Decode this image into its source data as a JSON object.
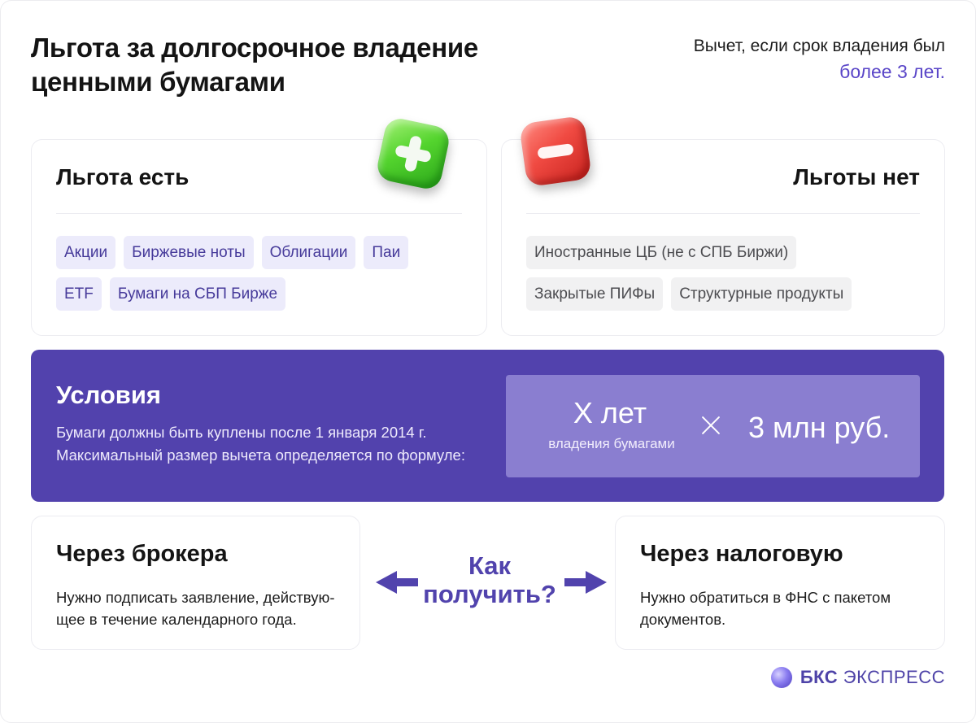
{
  "header": {
    "title": "Льгота за долгосрочное владение ценными бумагами",
    "note": "Вычет, если срок владения был",
    "note_accent": "более 3 лет."
  },
  "benefit_yes": {
    "heading": "Льгота есть",
    "icon": "plus-icon",
    "tags": [
      "Акции",
      "Биржевые ноты",
      "Облигации",
      "Паи",
      "ETF",
      "Бумаги на СБП Бирже"
    ]
  },
  "benefit_no": {
    "heading": "Льготы нет",
    "icon": "minus-icon",
    "tags": [
      "Иностранные ЦБ (не с СПБ Биржи)",
      "Закрытые ПИФы",
      "Структурные продукты"
    ]
  },
  "conditions": {
    "heading": "Условия",
    "line1": "Бумаги должны быть куплены после 1 января 2014 г.",
    "line2": "Максимальный размер вычета определяется по формуле:",
    "formula_years": "X лет",
    "formula_years_caption": "владения бумагами",
    "formula_operator": "×",
    "formula_amount": "3 млн руб."
  },
  "how_to": {
    "question": "Как получить?",
    "broker": {
      "heading": "Через брокера",
      "text": "Нужно подписать заявление, действую-щее в течение календарного года."
    },
    "tax": {
      "heading": "Через налоговую",
      "text": "Нужно обратиться в ФНС с пакетом документов."
    }
  },
  "logo": {
    "bold": "БКС",
    "regular": "ЭКСПРЕСС"
  },
  "colors": {
    "accent": "#5242ad",
    "accent_text": "#5a46c8",
    "plus": "#54d42e",
    "minus": "#f04a42"
  }
}
